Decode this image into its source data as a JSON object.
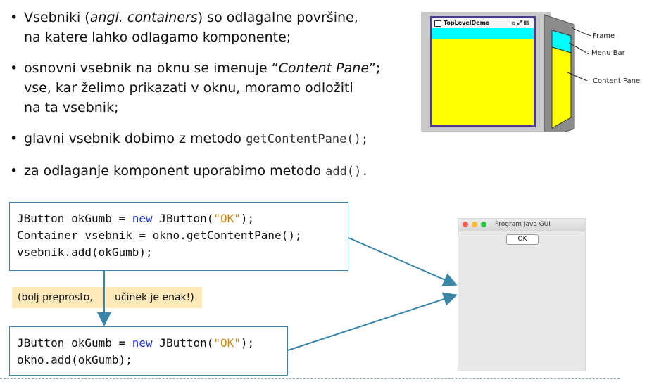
{
  "bullets": {
    "b1": {
      "pre": "Vsebniki (",
      "em": "angl. containers",
      "post": ") so odlagalne površine,",
      "line2": "na katere lahko odlagamo komponente;"
    },
    "b2": {
      "pre": "osnovni vsebnik na oknu se imenuje  “",
      "em": "Content Pane",
      "post": "”;",
      "line2": "vse, kar želimo prikazati v oknu, moramo odložiti",
      "line3": "na ta vsebnik;"
    },
    "b3": {
      "pre": "glavni vsebnik dobimo z metodo ",
      "code": "getContentPane();"
    },
    "b4": {
      "pre": "za odlaganje komponent uporabimo metodo ",
      "code": "add()."
    },
    "dot": "•"
  },
  "diagram": {
    "window_title": "TopLevelDemo",
    "window_controls": "▫⤢⊠",
    "labels": {
      "frame": "Frame",
      "menubar": "Menu Bar",
      "contentpane": "Content Pane"
    }
  },
  "code1": {
    "l1": {
      "a": "JButton okGumb = ",
      "kw": "new",
      "b": " JButton(",
      "s": "\"OK\"",
      "c": ");"
    },
    "l2": "Container vsebnik = okno.getContentPane();",
    "l3": "vsebnik.add(okGumb);"
  },
  "note": {
    "part1": "(bolj preprosto,",
    "part2": "učinek je enak!)"
  },
  "code2": {
    "l1": {
      "a": "JButton okGumb = ",
      "kw": "new",
      "b": " JButton(",
      "s": "\"OK\"",
      "c": ");"
    },
    "l2": "okno.add(okGumb);"
  },
  "mac": {
    "title": "Program Java GUI",
    "ok_label": "OK",
    "lights": [
      "#fc5f57",
      "#fdbc2e",
      "#28c840"
    ]
  }
}
